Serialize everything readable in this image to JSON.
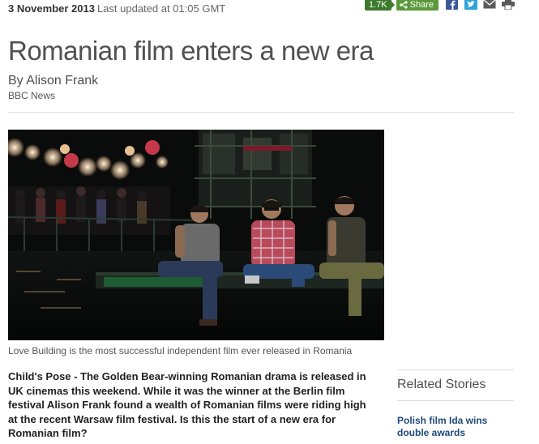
{
  "header": {
    "date": "3 November 2013",
    "updated": "Last updated at 01:05 GMT"
  },
  "share": {
    "count": "1.7K",
    "label": "Share",
    "icons": [
      "facebook-icon",
      "twitter-icon",
      "email-icon",
      "print-icon"
    ]
  },
  "article": {
    "title": "Romanian film enters a new era",
    "byline": "By Alison Frank",
    "organization": "BBC News",
    "image_caption": "Love Building is the most successful independent film ever released in Romania",
    "intro": "Child's Pose - The Golden Bear-winning Romanian drama is released in UK cinemas this weekend. While it was the winner at the Berlin film festival Alison Frank found a wealth of Romanian films were riding high at the recent Warsaw film festival. Is this the start of a new era for Romanian film?"
  },
  "related": {
    "title": "Related Stories",
    "items": [
      {
        "label": "Polish film Ida wins double awards"
      }
    ]
  },
  "colors": {
    "share_count_bg": "#3d7a2e",
    "share_button_bg": "#5a9a3a",
    "facebook": "#3b5998",
    "twitter": "#2ea5d8",
    "link": "#1f4a7a"
  }
}
